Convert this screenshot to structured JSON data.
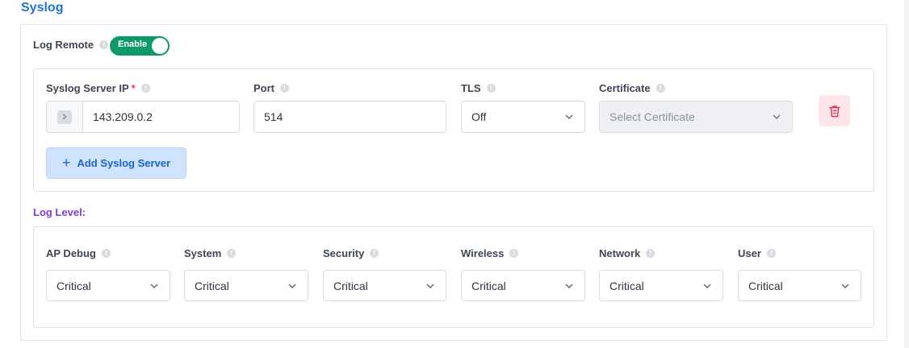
{
  "section": {
    "title": "Syslog"
  },
  "log_remote": {
    "label": "Log Remote",
    "toggle_text": "Enable",
    "enabled": true
  },
  "server": {
    "ip_label": "Syslog Server IP",
    "required_mark": "*",
    "ip_value": "143.209.0.2",
    "port_label": "Port",
    "port_value": "514",
    "tls_label": "TLS",
    "tls_value": "Off",
    "cert_label": "Certificate",
    "cert_placeholder": "Select Certificate"
  },
  "add_button": {
    "label": "Add Syslog Server"
  },
  "log_level": {
    "title": "Log Level:",
    "items": [
      {
        "label": "AP Debug",
        "value": "Critical"
      },
      {
        "label": "System",
        "value": "Critical"
      },
      {
        "label": "Security",
        "value": "Critical"
      },
      {
        "label": "Wireless",
        "value": "Critical"
      },
      {
        "label": "Network",
        "value": "Critical"
      },
      {
        "label": "User",
        "value": "Critical"
      }
    ]
  },
  "colors": {
    "title_blue": "#1e74d8",
    "toggle_green": "#109968",
    "log_level_purple": "#7a3fd1",
    "add_button_bg": "#cfe3ff",
    "delete_bg": "#fde6ea",
    "delete_icon": "#e0365a",
    "required_red": "#e5484d"
  },
  "icons": [
    "info-icon",
    "prompt-icon",
    "chevron-down-icon",
    "trash-icon",
    "plus-icon"
  ]
}
